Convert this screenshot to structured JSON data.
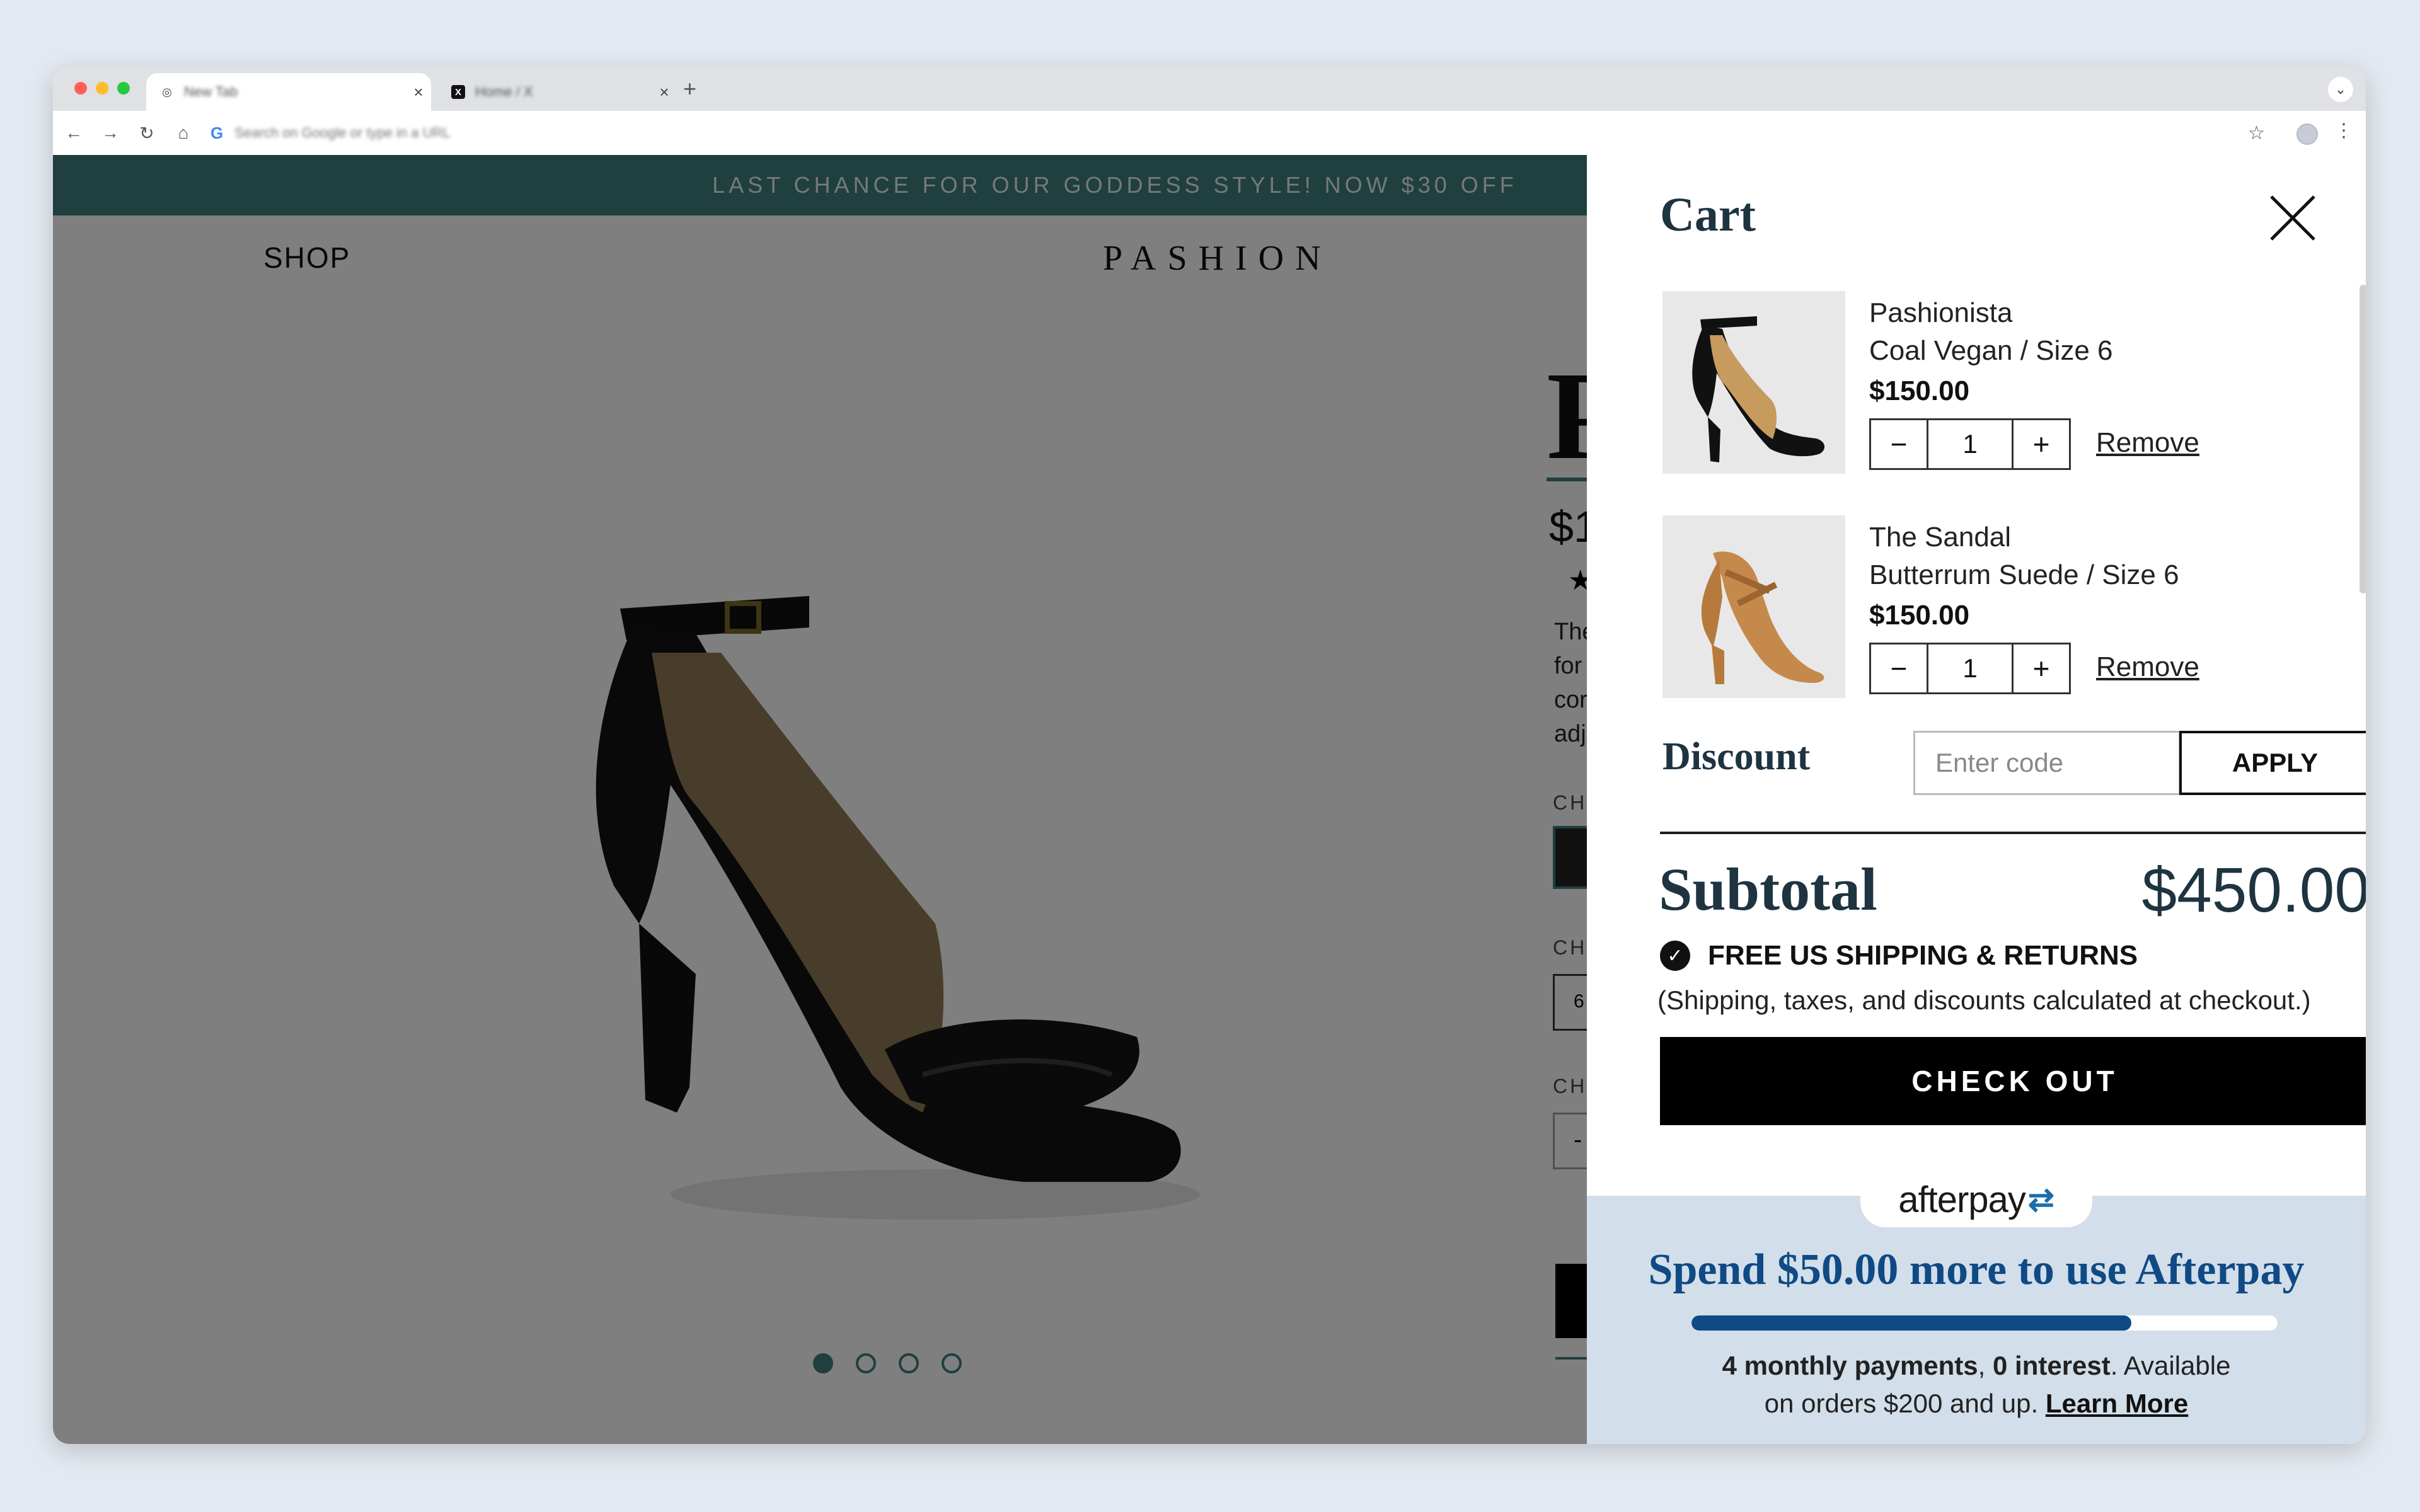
{
  "browser": {
    "tabs": [
      {
        "title": "New Tab",
        "close": "×"
      },
      {
        "title": "Home / X",
        "close": "×"
      }
    ],
    "new_tab": "+",
    "omnibox_placeholder": "Search on Google or type in a URL"
  },
  "site": {
    "announcement": "LAST CHANCE FOR OUR GODDESS STYLE! NOW $30 OFF",
    "nav_shop": "SHOP",
    "logo": "PASHION"
  },
  "product_partial": {
    "title": "P",
    "price": "$1",
    "star": "★",
    "desc_lines": [
      "The",
      "for",
      "cor",
      "adj"
    ],
    "label_color": "CH",
    "label_size": "CH",
    "label_qty": "CHO",
    "size_value": "6",
    "qty_value": "-"
  },
  "carousel": {
    "count": 4,
    "active": 0
  },
  "cart": {
    "title": "Cart",
    "items": [
      {
        "name": "Pashionista",
        "variant": "Coal Vegan / Size 6",
        "price": "$150.00",
        "qty": "1",
        "minus": "−",
        "plus": "+",
        "remove": "Remove"
      },
      {
        "name": "The Sandal",
        "variant": "Butterrum Suede  / Size 6",
        "price": "$150.00",
        "qty": "1",
        "minus": "−",
        "plus": "+",
        "remove": "Remove"
      }
    ],
    "discount_label": "Discount",
    "discount_placeholder": "Enter code",
    "apply_label": "APPLY",
    "subtotal_label": "Subtotal",
    "subtotal_value": "$450.00",
    "shipping": "FREE US SHIPPING & RETURNS",
    "note": "(Shipping, taxes, and discounts calculated at checkout.)",
    "checkout_label": "CHECK OUT"
  },
  "afterpay": {
    "logo_text": "afterpay",
    "headline": "Spend $50.00 more to use Afterpay",
    "progress": 0.75,
    "line1_b1": "4 monthly payments",
    "line1_sep": ", ",
    "line1_b2": "0 interest",
    "line1_rest": ". Available",
    "line2": "on orders $200 and up. ",
    "learn_more": "Learn More"
  },
  "colors": {
    "teal": "#3e7a7a",
    "navy": "#1e3440",
    "afterpay_blue": "#0f4a85",
    "afterpay_bg": "#d2deea"
  }
}
